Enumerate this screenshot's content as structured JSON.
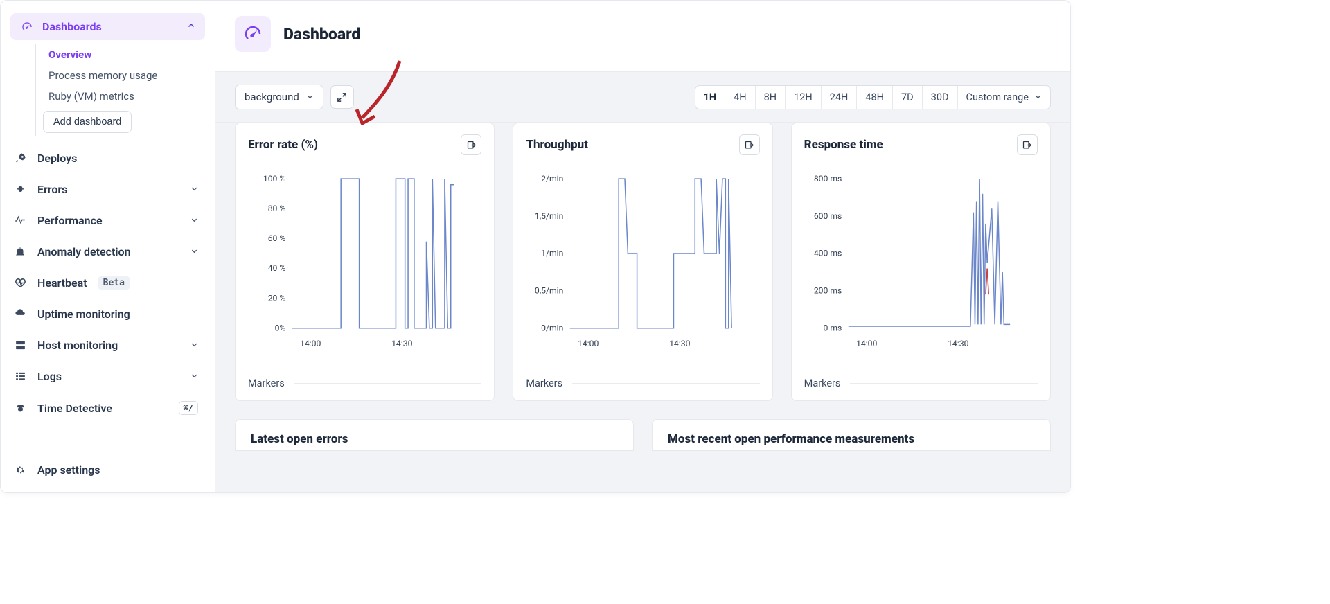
{
  "sidebar": {
    "dashboards_label": "Dashboards",
    "sub_items": [
      "Overview",
      "Process memory usage",
      "Ruby (VM) metrics"
    ],
    "add_dashboard": "Add dashboard",
    "items": [
      {
        "icon": "rocket",
        "label": "Deploys",
        "chevron": false
      },
      {
        "icon": "bug",
        "label": "Errors",
        "chevron": true
      },
      {
        "icon": "speed",
        "label": "Performance",
        "chevron": true
      },
      {
        "icon": "alert",
        "label": "Anomaly detection",
        "chevron": true
      },
      {
        "icon": "heart",
        "label": "Heartbeat",
        "chevron": false,
        "badge": "Beta"
      },
      {
        "icon": "uptime",
        "label": "Uptime monitoring",
        "chevron": false
      },
      {
        "icon": "host",
        "label": "Host monitoring",
        "chevron": true
      },
      {
        "icon": "logs",
        "label": "Logs",
        "chevron": true
      },
      {
        "icon": "detective",
        "label": "Time Detective",
        "chevron": false,
        "kbd": "⌘/"
      }
    ],
    "bottom_item": {
      "icon": "gear",
      "label": "App settings"
    }
  },
  "header": {
    "title": "Dashboard"
  },
  "toolbar": {
    "namespace_selected": "background",
    "time_ranges": [
      "1H",
      "4H",
      "8H",
      "12H",
      "24H",
      "48H",
      "7D",
      "30D"
    ],
    "custom_range": "Custom range"
  },
  "cards": [
    {
      "title": "Error rate (%)",
      "footer": "Markers"
    },
    {
      "title": "Throughput",
      "footer": "Markers"
    },
    {
      "title": "Response time",
      "footer": "Markers"
    }
  ],
  "bottom_cards": [
    {
      "title": "Latest open errors"
    },
    {
      "title": "Most recent open performance measurements"
    }
  ],
  "chart_data": [
    {
      "type": "line",
      "title": "Error rate (%)",
      "y_ticks": [
        "100 %",
        "80 %",
        "60 %",
        "40 %",
        "20 %",
        "0%"
      ],
      "x_ticks": [
        "14:00",
        "14:30"
      ],
      "ylim": [
        0,
        100
      ],
      "xrange_minutes": [
        -6,
        54
      ],
      "series": [
        {
          "name": "error_rate",
          "values": [
            [
              -6,
              0
            ],
            [
              10,
              0
            ],
            [
              10,
              100
            ],
            [
              16,
              100
            ],
            [
              16,
              0
            ],
            [
              28,
              0
            ],
            [
              28,
              100
            ],
            [
              31,
              100
            ],
            [
              31,
              0
            ],
            [
              32,
              0
            ],
            [
              32,
              100
            ],
            [
              34,
              100
            ],
            [
              34,
              0
            ],
            [
              38,
              0
            ],
            [
              38,
              58
            ],
            [
              39,
              0
            ],
            [
              40,
              0
            ],
            [
              40,
              100
            ],
            [
              41,
              0
            ],
            [
              44,
              0
            ],
            [
              44,
              100
            ],
            [
              45,
              0
            ],
            [
              46,
              0
            ],
            [
              46,
              96
            ],
            [
              47,
              96
            ]
          ]
        }
      ]
    },
    {
      "type": "line",
      "title": "Throughput",
      "y_ticks": [
        "2/min",
        "1,5/min",
        "1/min",
        "0,5/min",
        "0/min"
      ],
      "x_ticks": [
        "14:00",
        "14:30"
      ],
      "ylim": [
        0,
        2
      ],
      "xrange_minutes": [
        -6,
        54
      ],
      "series": [
        {
          "name": "throughput",
          "values": [
            [
              -6,
              0
            ],
            [
              10,
              0
            ],
            [
              10,
              2
            ],
            [
              12,
              2
            ],
            [
              13,
              1
            ],
            [
              16,
              1
            ],
            [
              16,
              0
            ],
            [
              28,
              0
            ],
            [
              28,
              1
            ],
            [
              35,
              1
            ],
            [
              35,
              2
            ],
            [
              37,
              2
            ],
            [
              38,
              1
            ],
            [
              42,
              1
            ],
            [
              42,
              2
            ],
            [
              43,
              1
            ],
            [
              44,
              2
            ],
            [
              45,
              2
            ],
            [
              45,
              0
            ],
            [
              46,
              0
            ],
            [
              46,
              2
            ],
            [
              47,
              0
            ]
          ]
        }
      ]
    },
    {
      "type": "line",
      "title": "Response time",
      "y_ticks": [
        "800 ms",
        "600 ms",
        "400 ms",
        "200 ms",
        "0 ms"
      ],
      "x_ticks": [
        "14:00",
        "14:30"
      ],
      "ylim": [
        0,
        800
      ],
      "xrange_minutes": [
        -6,
        54
      ],
      "series": [
        {
          "name": "mean",
          "values": [
            [
              -6,
              10
            ],
            [
              34,
              10
            ],
            [
              35,
              620
            ],
            [
              35.5,
              20
            ],
            [
              36,
              680
            ],
            [
              36.5,
              20
            ],
            [
              37,
              800
            ],
            [
              37.5,
              20
            ],
            [
              38,
              720
            ],
            [
              38.5,
              20
            ],
            [
              39,
              560
            ],
            [
              39.5,
              350
            ],
            [
              41,
              640
            ],
            [
              42,
              20
            ],
            [
              43,
              680
            ],
            [
              44,
              20
            ],
            [
              44.5,
              300
            ],
            [
              45,
              20
            ],
            [
              47,
              20
            ]
          ]
        },
        {
          "name": "p95",
          "color": "#c44343",
          "values": [
            [
              39,
              180
            ],
            [
              39.5,
              320
            ],
            [
              40,
              180
            ]
          ]
        }
      ]
    }
  ]
}
